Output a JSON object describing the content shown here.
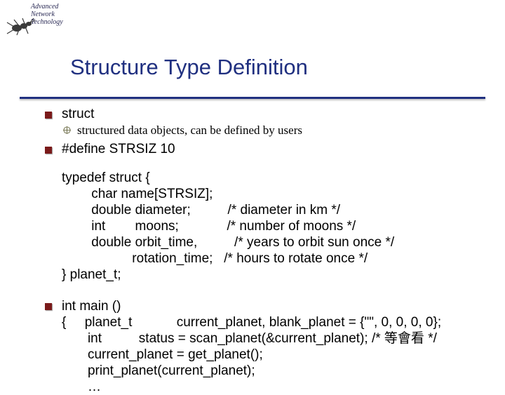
{
  "logo": {
    "line1": "Advanced",
    "line2": "Network",
    "line3": "Technology"
  },
  "title": "Structure Type Definition",
  "bullets": {
    "b1": "struct",
    "b1sub": "structured data objects, can be defined by users",
    "b2": "#define STRSIZ 10"
  },
  "code1": "typedef struct {\n        char name[STRSIZ];\n        double diameter;          /* diameter in km */\n        int        moons;             /* number of moons */\n        double orbit_time,          /* years to orbit sun once */\n                   rotation_time;   /* hours to rotate once */\n} planet_t;",
  "code2": "int main ()\n{     planet_t            current_planet, blank_planet = {\"\", 0, 0, 0, 0};\n       int          status = scan_planet(&current_planet); /* 等會看 */\n       current_planet = get_planet();\n       print_planet(current_planet);\n       …"
}
